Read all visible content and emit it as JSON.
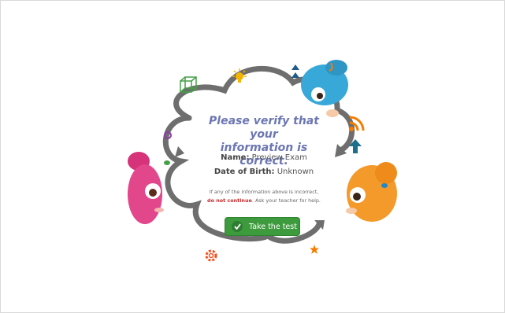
{
  "verify": {
    "title_line1": "Please verify that your",
    "title_line2": "information is correct.",
    "name_label": "Name:",
    "name_value": "Preview Exam",
    "dob_label": "Date of Birth:",
    "dob_value": "Unknown",
    "note_line1": "If any of the information above is incorrect,",
    "note_warn": "do not continue",
    "note_after": ". Ask your teacher for help."
  },
  "start_button": {
    "label": "Take the test"
  },
  "colors": {
    "title": "#6b76b3",
    "button": "#3d9b3d",
    "warning": "#c62828"
  },
  "icons": [
    "cube-icon",
    "lightbulb-icon",
    "rss-icon",
    "arrow-up-icon",
    "gear-icon",
    "star-icon",
    "circle-icon",
    "triangle-icon"
  ],
  "characters": [
    "pink-monster-character",
    "blue-monster-character",
    "orange-monster-character"
  ]
}
